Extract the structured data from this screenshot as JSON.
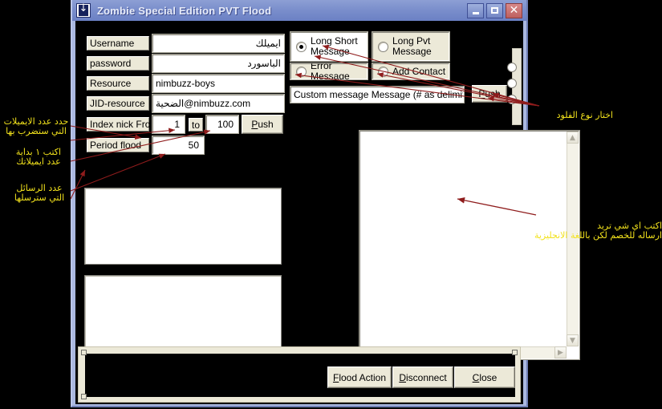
{
  "window": {
    "title": "Zombie Special Edition PVT Flood",
    "icon": "download-arrow-icon",
    "buttons": {
      "minimize": "minimize-icon",
      "maximize": "maximize-icon",
      "close": "close-icon"
    }
  },
  "form": {
    "fields": [
      {
        "label": "Username",
        "value": "ايميلك",
        "rtl": true
      },
      {
        "label": "password",
        "value": "الباسورد",
        "rtl": true
      },
      {
        "label": "Resource",
        "value": "nimbuzz-boys",
        "rtl": false
      },
      {
        "label": "JID-resource",
        "value": "الضحية@nimbuzz.com",
        "rtl": true
      }
    ],
    "index_row": {
      "label": "Index nick From",
      "from_value": "1",
      "to_label": "to",
      "to_value": "100",
      "push_label": "Push",
      "push_accel": "P"
    },
    "period_row": {
      "label": "Period flood",
      "value": "50"
    }
  },
  "flood_types": {
    "options": [
      {
        "label": "Long Short\nMessage",
        "selected": true,
        "style": "white"
      },
      {
        "label": "Long Pvt\nMessage",
        "selected": false,
        "style": "beige"
      },
      {
        "label": "Error Message",
        "selected": false,
        "style": "beige"
      },
      {
        "label": "Add Contact",
        "selected": false,
        "style": "beige"
      }
    ]
  },
  "custom_message": {
    "text": "Custom message  Message (# as delimitter)",
    "push_label": "Push",
    "push_accel": "P"
  },
  "message_area": {
    "value": "",
    "placeholder": "",
    "scroll_up": "chevron-up-icon",
    "scroll_down": "chevron-down-icon",
    "scroll_left": "chevron-left-icon",
    "scroll_right": "chevron-right-icon"
  },
  "listboxes": [
    {
      "name": "log-list-upper",
      "items": []
    },
    {
      "name": "log-list-lower",
      "items": []
    }
  ],
  "footer": {
    "buttons": [
      {
        "label": "Flood Action",
        "accel": "F"
      },
      {
        "label": "Disconnect",
        "accel": "D"
      },
      {
        "label": "Close",
        "accel": "C"
      }
    ]
  },
  "annotations": [
    {
      "id": "anno-emails-count",
      "text": "حدد عدد الايميلات\nالتي ستضرب بها"
    },
    {
      "id": "anno-start-index",
      "text": "اكتب ١ بداية\nعدد ايميلاتك"
    },
    {
      "id": "anno-messages-count",
      "text": "عدد الرسائل\nالتي سترسلها"
    },
    {
      "id": "anno-flood-type",
      "text": "اختار نوع الفلود"
    },
    {
      "id": "anno-message-text",
      "text": "اكتب اي شي تريد\nارساله للخصم لكن باللغة الانجليزية"
    }
  ],
  "colors": {
    "annotation": "#f2e21c",
    "arrow": "#8f1c1c",
    "title_gradient_start": "#8d9fd4",
    "face": "#ece9d8",
    "canvas": "#000000"
  }
}
